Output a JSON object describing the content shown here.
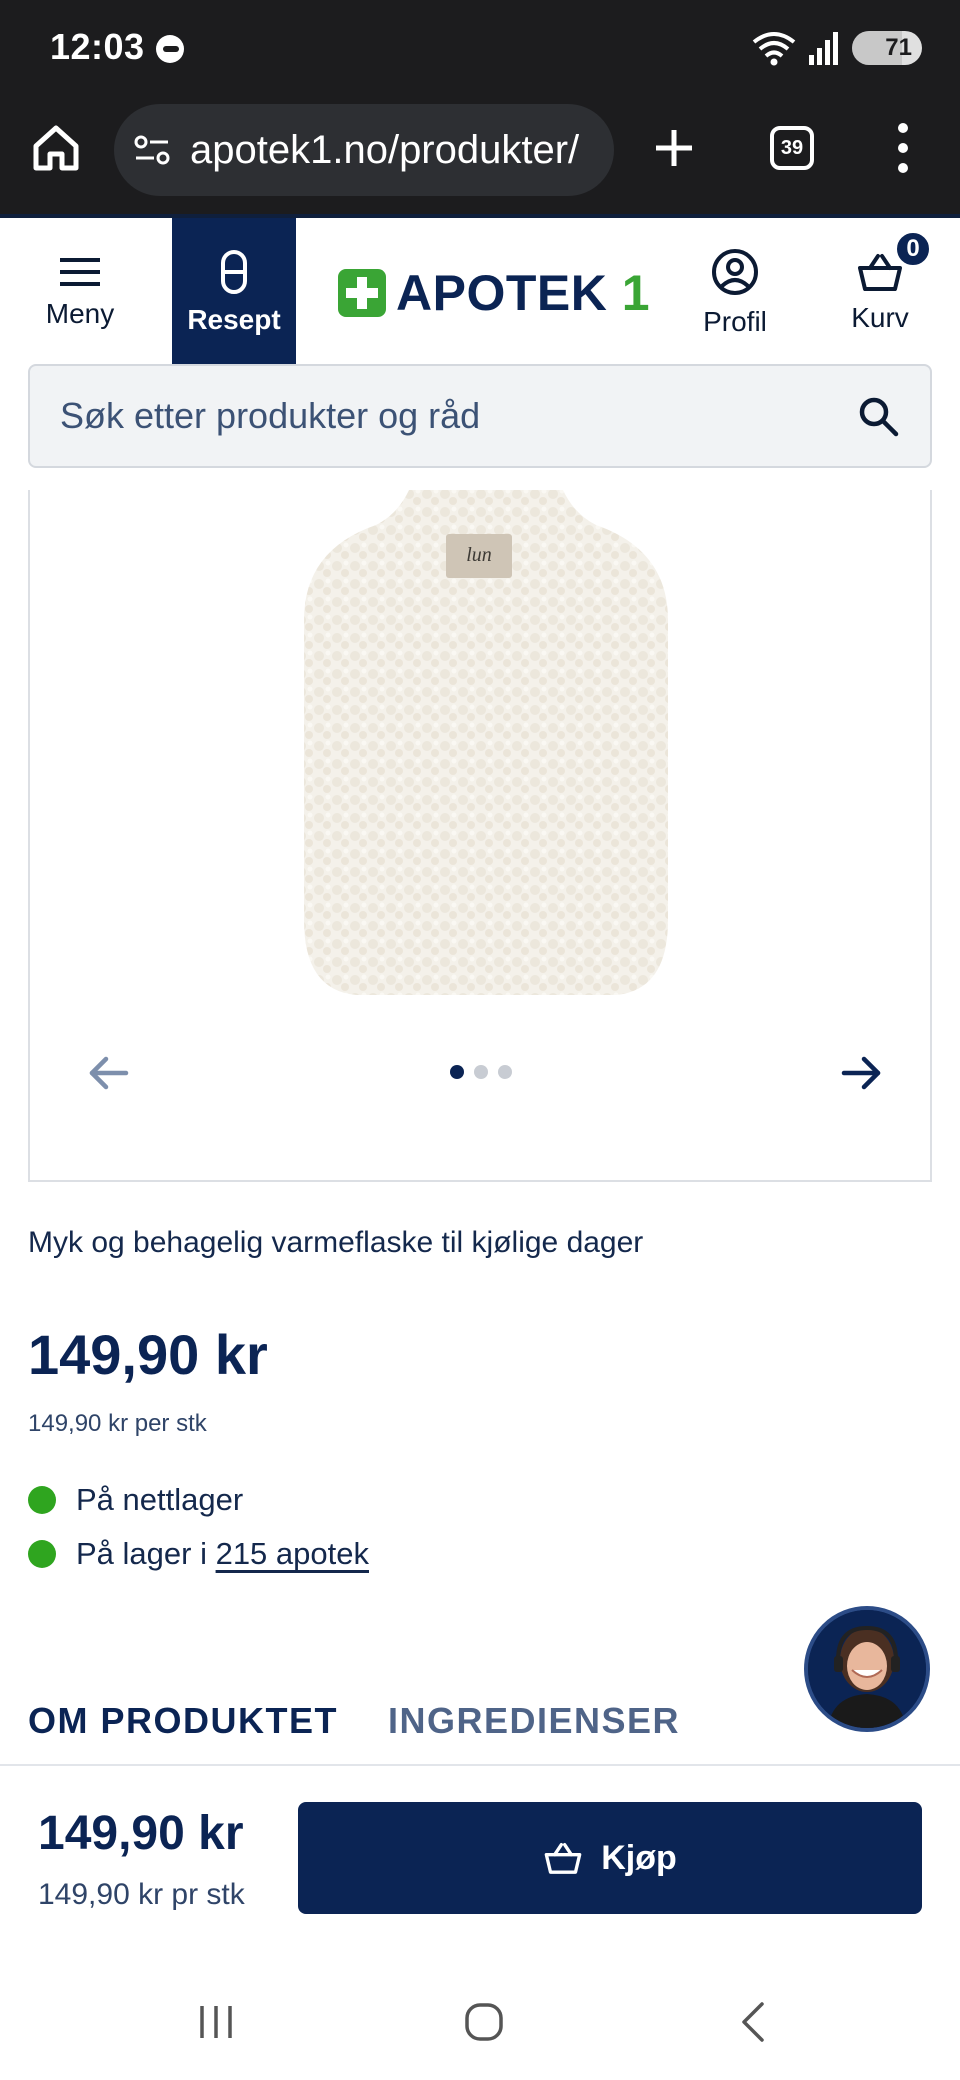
{
  "status_bar": {
    "time": "12:03",
    "battery": "71"
  },
  "browser": {
    "url": "apotek1.no/produkter/",
    "tab_count": "39"
  },
  "header": {
    "menu_label": "Meny",
    "prescription_label": "Resept",
    "logo_text": "APOTEK",
    "logo_number": "1",
    "profile_label": "Profil",
    "cart_label": "Kurv",
    "cart_count": "0"
  },
  "search": {
    "placeholder": "Søk etter produkter og råd"
  },
  "gallery": {
    "product_brand_tag": "lun",
    "image_count": 3,
    "active_index": 0
  },
  "product": {
    "description": "Myk og behagelig varmeflaske til kjølige dager",
    "price": "149,90 kr",
    "unit_price": "149,90 kr per stk",
    "stock_online": "På nettlager",
    "stock_pharmacy_prefix": "På lager i ",
    "stock_pharmacy_link": "215 apotek"
  },
  "tabs": [
    {
      "label": "OM PRODUKTET",
      "active": true
    },
    {
      "label": "INGREDIENSER",
      "active": false
    }
  ],
  "buy_bar": {
    "price": "149,90 kr",
    "unit_price": "149,90 kr pr stk",
    "button_label": "Kjøp"
  },
  "colors": {
    "brand_navy": "#0b2454",
    "brand_green": "#3aa535",
    "stock_green": "#2fa51f"
  }
}
